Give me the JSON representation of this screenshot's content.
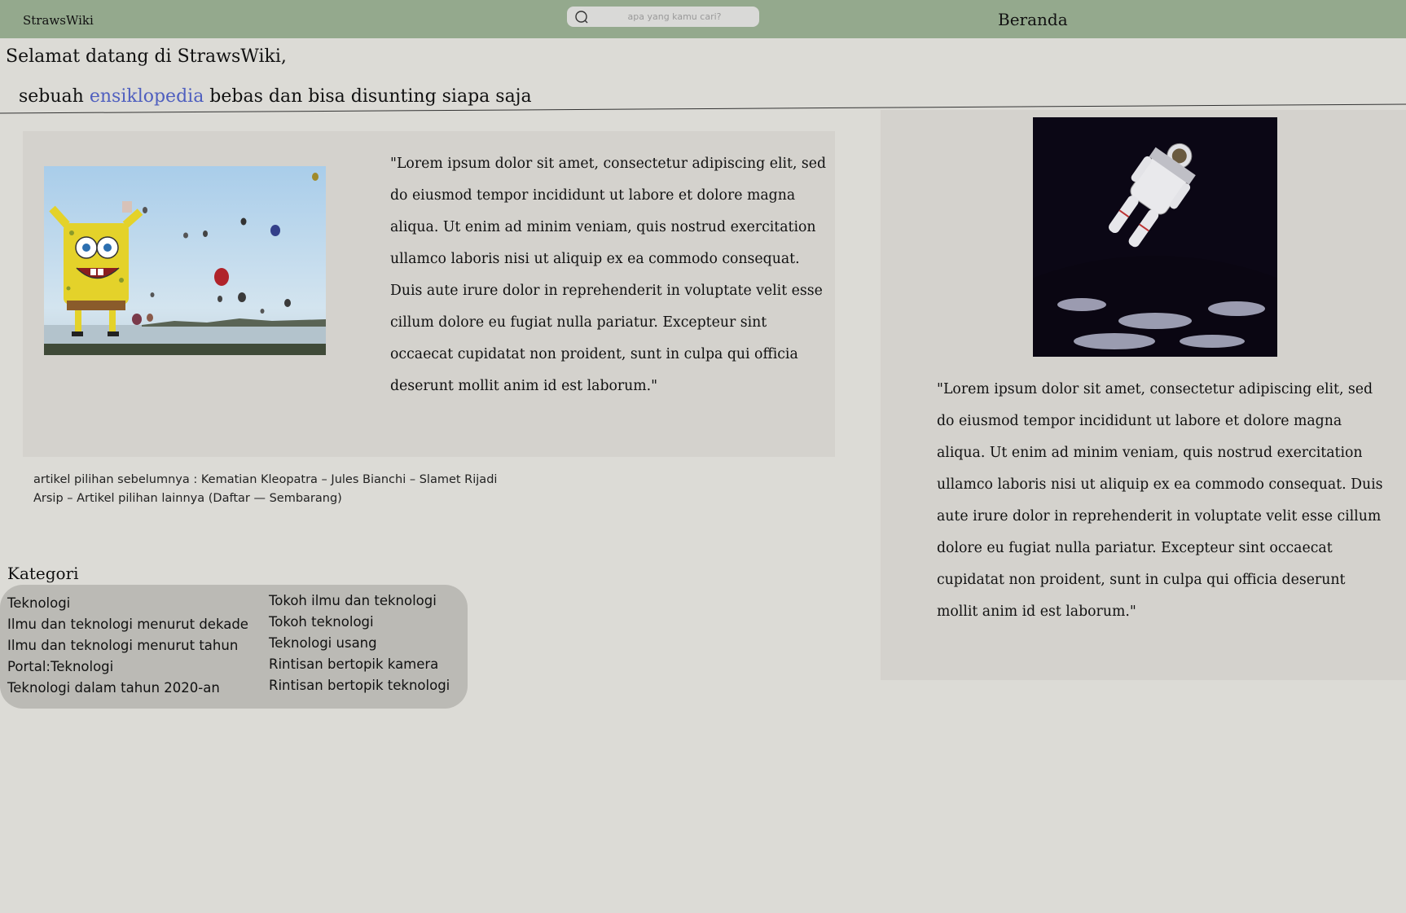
{
  "header": {
    "brand": "StrawsWiki",
    "search_placeholder": "apa yang kamu cari?",
    "nav_home": "Beranda"
  },
  "welcome": {
    "title": "Selamat datang di StrawsWiki,",
    "sub_before": "sebuah ",
    "sub_link": "ensiklopedia",
    "sub_after": " bebas dan bisa disunting siapa saja"
  },
  "featured": {
    "image_icon": "spongebob-balloon-photo",
    "text": "\"Lorem ipsum dolor sit amet, consectetur adipiscing elit, sed do eiusmod tempor incididunt ut labore et dolore magna aliqua. Ut enim ad minim veniam, quis nostrud exercitation ullamco laboris nisi ut aliquip ex ea commodo consequat. Duis aute irure dolor in reprehenderit in voluptate velit esse cillum dolore eu fugiat nulla pariatur. Excepteur sint occaecat cupidatat non proident, sunt in culpa qui officia deserunt mollit anim id est laborum.\""
  },
  "previous": {
    "label": "artikel pilihan sebelumnya : ",
    "links": [
      "Kematian Kleopatra",
      "Jules Bianchi",
      "Slamet Rijadi"
    ],
    "sep": " – ",
    "archive": "Arsip",
    "more": "Artikel pilihan lainnya",
    "list": "Daftar",
    "dash": " — ",
    "random": "Sembarang"
  },
  "categories": {
    "heading": "Kategori",
    "left": [
      "Teknologi",
      "Ilmu dan teknologi menurut dekade",
      "Ilmu dan teknologi menurut tahun",
      "Portal:Teknologi",
      "Teknologi dalam tahun 2020-an"
    ],
    "right": [
      "Tokoh ilmu dan teknologi",
      "Tokoh teknologi",
      "Teknologi usang",
      "Rintisan bertopik kamera",
      "Rintisan bertopik teknologi"
    ]
  },
  "side": {
    "image_icon": "astronaut-earth-photo",
    "text": "\"Lorem ipsum dolor sit amet, consectetur adipiscing elit, sed do eiusmod tempor incididunt ut labore et dolore magna aliqua. Ut enim ad minim veniam, quis nostrud exercitation ullamco laboris nisi ut aliquip ex ea commodo consequat. Duis aute irure dolor in reprehenderit in voluptate velit esse cillum dolore eu fugiat nulla pariatur. Excepteur sint occaecat cupidatat non proident, sunt in culpa qui officia deserunt mollit anim id est laborum.\""
  }
}
